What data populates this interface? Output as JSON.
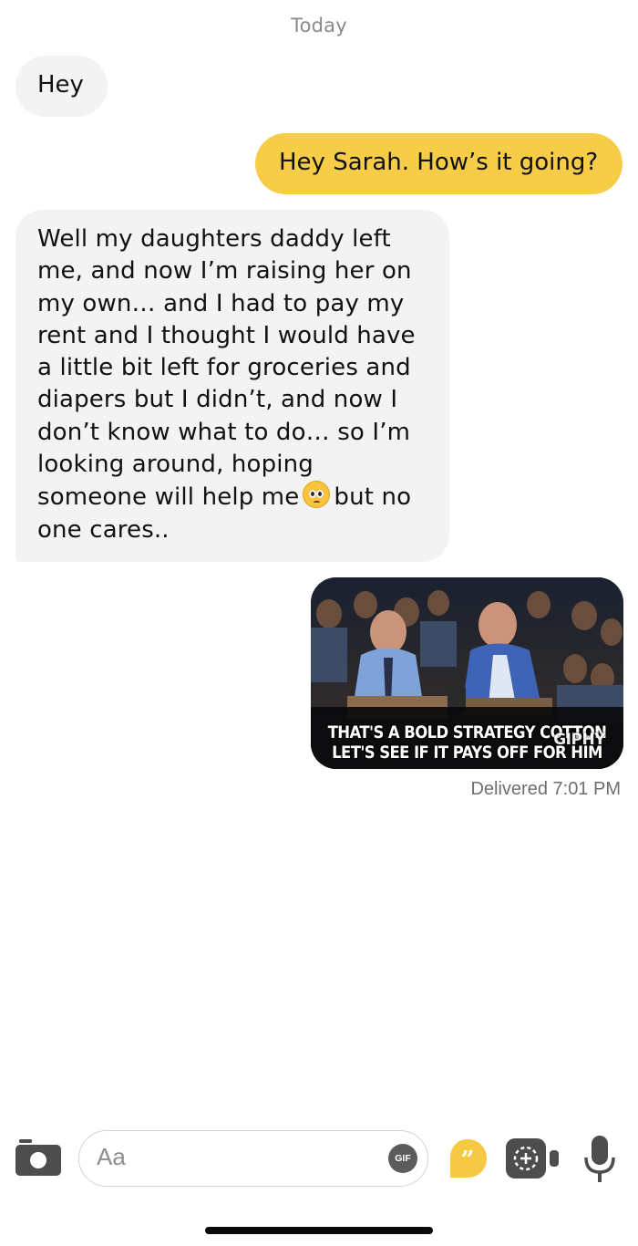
{
  "thread": {
    "date_header": "Today",
    "messages": [
      {
        "direction": "incoming",
        "text": "Hey"
      },
      {
        "direction": "outgoing",
        "text": "Hey Sarah. How’s it going?"
      },
      {
        "direction": "incoming",
        "text_before_emoji": "Well my daughters daddy left me, and now I’m raising her on my own… and I had to pay my rent and I thought I would have a little bit left for groceries and diapers but I didn’t, and now I don’t know what to do… so I’m looking around, hoping someone will help me",
        "emoji": "pleading-face-emoji",
        "text_after_emoji": "but no one cares.."
      },
      {
        "direction": "outgoing",
        "type": "gif",
        "caption_line1": "THAT'S A BOLD STRATEGY COTTON",
        "caption_line2": "LET'S SEE IF IT PAYS OFF FOR HIM",
        "watermark": "GIPHY"
      }
    ],
    "delivery_status": "Delivered 7:01 PM"
  },
  "composer": {
    "placeholder": "Aa",
    "gif_label": "GIF",
    "icons": [
      "camera-icon",
      "gif-icon",
      "bumble-opening-moves-icon",
      "video-call-icon",
      "microphone-icon"
    ]
  },
  "colors": {
    "outgoing_bubble": "#f7cc47",
    "incoming_bubble": "#f3f3f3",
    "accent": "#f9c33d"
  }
}
